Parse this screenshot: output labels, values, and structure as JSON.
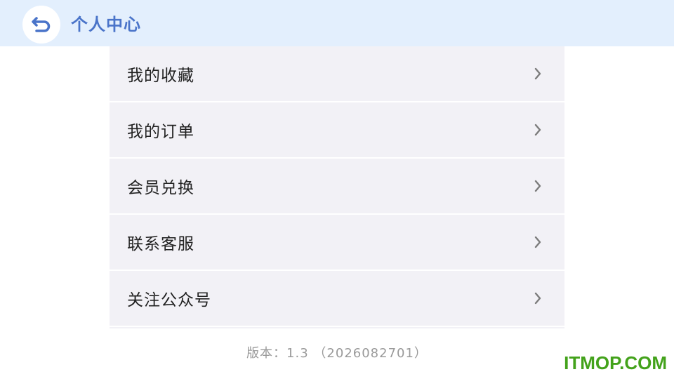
{
  "header": {
    "title": "个人中心",
    "back_icon": "back-return-icon",
    "accent_color": "#4a74c9",
    "background": "#e3effd"
  },
  "menu": {
    "items": [
      {
        "label": "我的收藏",
        "icon": "chevron-right-icon"
      },
      {
        "label": "我的订单",
        "icon": "chevron-right-icon"
      },
      {
        "label": "会员兑换",
        "icon": "chevron-right-icon"
      },
      {
        "label": "联系客服",
        "icon": "chevron-right-icon"
      },
      {
        "label": "关注公众号",
        "icon": "chevron-right-icon"
      }
    ]
  },
  "footer": {
    "version": "版本：1.3 （2026082701）"
  },
  "watermark": {
    "text": "ITMOP.COM",
    "color": "#43a21b"
  }
}
